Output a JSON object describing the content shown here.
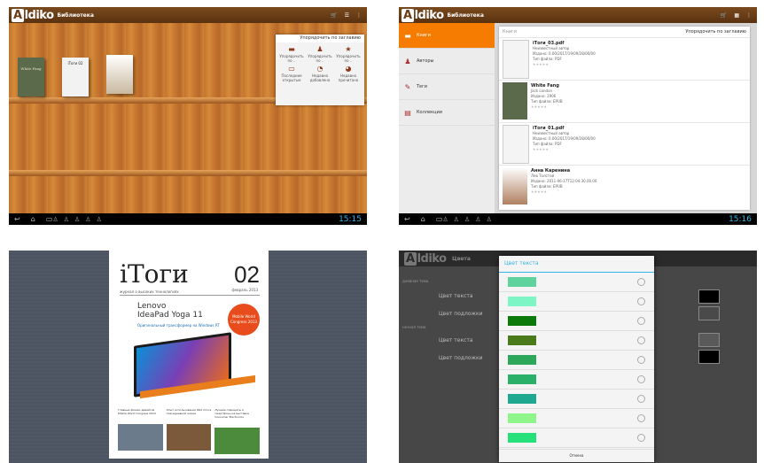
{
  "panel1": {
    "app_title": "Библиотека",
    "action_icons": [
      "cart-icon",
      "list-icon",
      "overflow-icon"
    ],
    "dropdown_title": "Упорядочить по заглавию",
    "dropdown_items": [
      {
        "label": "Упорядочить по ..",
        "icon": "book-icon"
      },
      {
        "label": "Упорядочить по ..",
        "icon": "person-icon"
      },
      {
        "label": "Упорядочить по ..",
        "icon": "star-icon"
      },
      {
        "label": "Последние открытые",
        "icon": "book-open-icon"
      },
      {
        "label": "Недавно добавлено",
        "icon": "clock-icon"
      },
      {
        "label": "Недавно прочитано",
        "icon": "clock-icon"
      }
    ],
    "book_covers": [
      "White Fang",
      "iTоги 02",
      "book-3"
    ],
    "clock": "15:15"
  },
  "panel2": {
    "app_title": "Библиотека",
    "sidebar": [
      {
        "label": "Книги",
        "icon": "book-icon",
        "active": true
      },
      {
        "label": "Авторы",
        "icon": "person-icon",
        "active": false
      },
      {
        "label": "Теги",
        "icon": "tag-icon",
        "active": false
      },
      {
        "label": "Коллекции",
        "icon": "collection-icon",
        "active": false
      }
    ],
    "list_header": "Книги",
    "sort_label": "Упорядочить по заглавию",
    "books": [
      {
        "title": "iTоги_03.pdf",
        "author": "Неизвестный автор",
        "meta1": "Издано: 0.00/2017/19/09/28/00/00",
        "meta2": "Тип файла: PDF",
        "stars": "★★★★★"
      },
      {
        "title": "White Fang",
        "author": "Jack London",
        "meta1": "Издано: 1906",
        "meta2": "Тип файла: EPUB",
        "stars": "★★★★★"
      },
      {
        "title": "iTоги_01.pdf",
        "author": "Неизвестный автор",
        "meta1": "Издано: 0.00/2017/19/09/28/00/00",
        "meta2": "Тип файла: PDF",
        "stars": "★★★★★"
      },
      {
        "title": "Анна Каренина",
        "author": "Лев Толстой",
        "meta1": "Издано: 2011-06-17T12:04:30.00.00",
        "meta2": "Тип файла: EPUB",
        "stars": "★★★★★"
      }
    ],
    "clock": "15:16"
  },
  "panel3": {
    "magazine": {
      "brand": "iТоги",
      "issue": "02",
      "tagline": "журнал о высоких технологиях",
      "date": "февраль 2013",
      "headline_1": "Lenovo",
      "headline_2": "IdeaPad Yoga 11",
      "subhead": "Оригинальный трансформер на Windows RT",
      "badge": "Mobile World Congress 2013",
      "bottom_items": [
        "Главные фишки девайсов Mobile World Congress 2013",
        "Опыт использования iPad mini в повседневной жизни",
        "Лучшие планшеты и смартфоны на выставке Consumer Electronics"
      ]
    }
  },
  "panel4": {
    "app_title": "Цвета",
    "dialog_title": "Цвет текста",
    "cancel_label": "Отмена",
    "settings": [
      {
        "label": "дневная тема",
        "kind": "section"
      },
      {
        "label": "Цвет текста",
        "kind": "row",
        "swatch": "#000000"
      },
      {
        "label": "Цвет подложки",
        "kind": "row",
        "swatch": "#4a4a4a"
      },
      {
        "label": "ночная тема",
        "kind": "section"
      },
      {
        "label": "Цвет текста",
        "kind": "row",
        "swatch": "#5a5a5a"
      },
      {
        "label": "Цвет подложки",
        "kind": "row",
        "swatch": "#000000"
      }
    ],
    "colors": [
      "#5fd39e",
      "#7ef5c5",
      "#0b7a0b",
      "#4a7a1a",
      "#2da85a",
      "#2bb06a",
      "#1fa890",
      "#8ef58a",
      "#26e07a"
    ]
  }
}
